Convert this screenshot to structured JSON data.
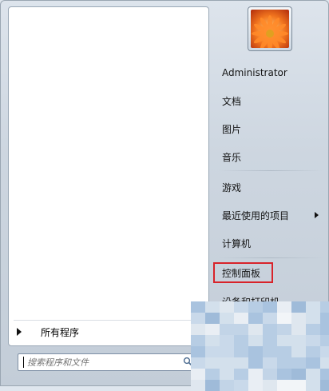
{
  "start_menu": {
    "all_programs_label": "所有程序",
    "search": {
      "placeholder": "搜索程序和文件"
    },
    "user_name": "Administrator",
    "right_items": [
      {
        "label": "文档",
        "has_submenu": false
      },
      {
        "label": "图片",
        "has_submenu": false
      },
      {
        "label": "音乐",
        "has_submenu": false
      },
      {
        "label": "游戏",
        "has_submenu": false
      },
      {
        "label": "最近使用的项目",
        "has_submenu": true
      },
      {
        "label": "计算机",
        "has_submenu": false
      },
      {
        "label": "控制面板",
        "has_submenu": false,
        "highlighted": true
      },
      {
        "label": "设备和打印机",
        "has_submenu": false
      }
    ]
  },
  "colors": {
    "highlight_border": "#d8232a",
    "menu_background": "#cdd6e0",
    "avatar_flower": "#f06a1c"
  },
  "icons": [
    "right-arrow-icon",
    "search-icon",
    "submenu-arrow-icon"
  ]
}
